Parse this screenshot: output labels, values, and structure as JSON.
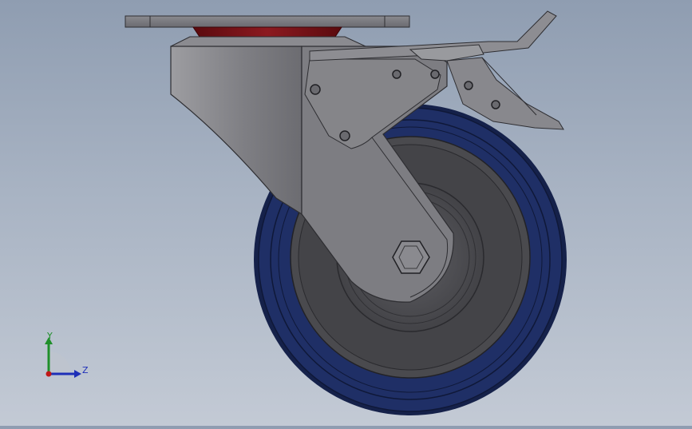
{
  "scene": {
    "model": "swivel-caster-with-brake",
    "background_top": "#8f9db1",
    "background_bottom": "#c3cad5",
    "colors": {
      "steel_light": "#a3a3a7",
      "steel_mid": "#7b7b80",
      "steel_dark": "#56565a",
      "tire": "#1f2f66",
      "tire_dark": "#15214a",
      "hub": "#4b4b4f",
      "bearing_red": "#7b0f14"
    }
  },
  "triad": {
    "y_label": "Y",
    "z_label": "Z",
    "y_color": "#1f8f2a",
    "z_color": "#1e2fb8",
    "x_color": "#c01818"
  }
}
